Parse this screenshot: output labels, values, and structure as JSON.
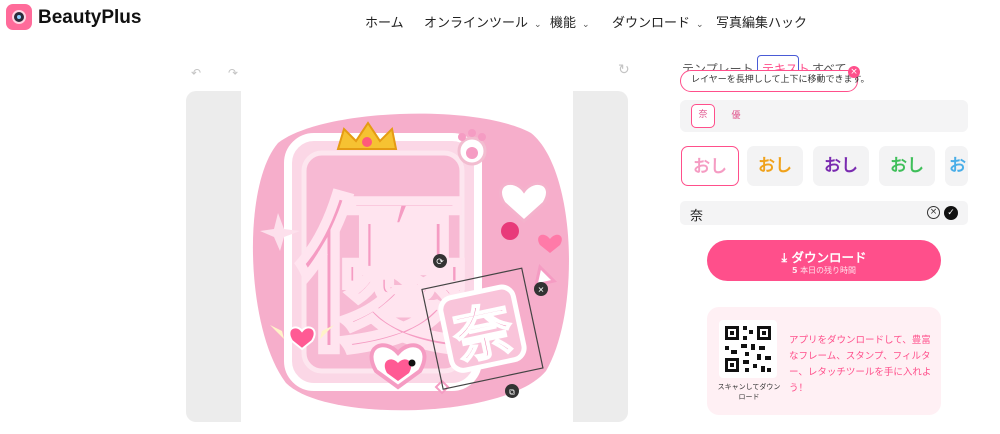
{
  "brand": {
    "name": "BeautyPlus",
    "logo_icon": "camera-lens-logo-icon"
  },
  "nav": [
    {
      "label": "ホーム",
      "dropdown": false
    },
    {
      "label": "オンラインツール",
      "dropdown": true
    },
    {
      "label": "機能",
      "dropdown": true
    },
    {
      "label": "ダウンロード",
      "dropdown": true
    },
    {
      "label": "写真編集ハック",
      "dropdown": false
    }
  ],
  "nav_caret": "⌄",
  "toolbar": {
    "undo_icon": "↶",
    "redo_icon": "↷",
    "reset_icon": "↻"
  },
  "canvas": {
    "large_char": "優",
    "selected_char": "奈",
    "rotate_icon": "⟳",
    "close_icon": "✕",
    "duplicate_icon": "⧉"
  },
  "panel": {
    "tabs": [
      "テンプレート",
      "テキスト",
      "すべて"
    ],
    "active_tab": "テキスト",
    "tooltip": "レイヤーを長押しして上下に移動できます。",
    "tooltip_close": "×",
    "layer_chips": [
      "奈",
      "優"
    ],
    "style_sample": "おし",
    "text_value": "奈",
    "clear_icon": "×",
    "confirm_icon": "✓"
  },
  "download": {
    "icon": "⤓",
    "label": "ダウンロード",
    "count": "5",
    "remaining": "本日の残り時間"
  },
  "promo": {
    "qr_caption": "スキャンしてダウンロード",
    "text": "アプリをダウンロードして、豊富なフレーム、スタンプ、フィルター、レタッチツールを手に入れよう！"
  },
  "colors": {
    "accent": "#ff4f8b",
    "tab_outline": "#4a5bd6",
    "canvas_pink": "#f6aecb"
  }
}
